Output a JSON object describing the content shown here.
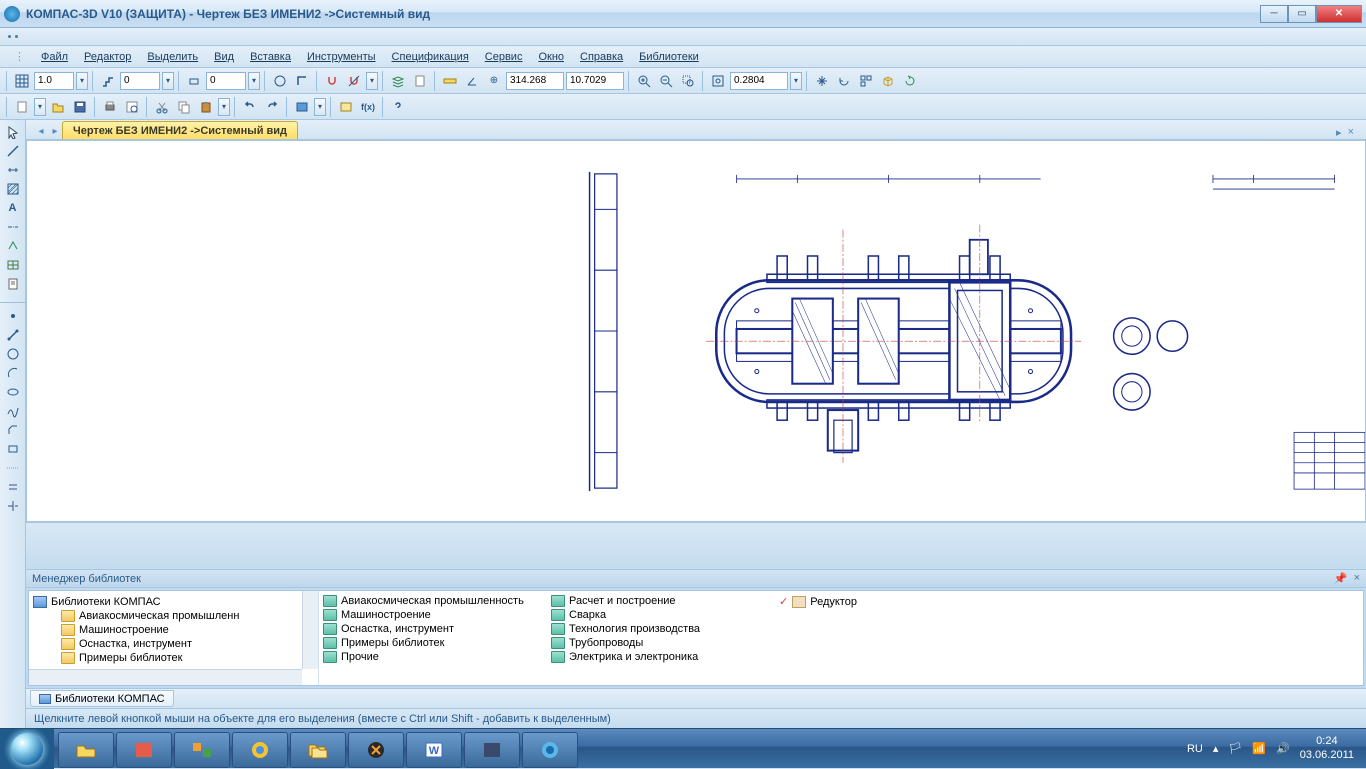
{
  "title": "КОМПАС-3D V10 (ЗАЩИТА) - Чертеж БЕЗ ИМЕНИ2 ->Системный вид",
  "menu": {
    "file": "Файл",
    "editor": "Редактор",
    "select": "Выделить",
    "view": "Вид",
    "insert": "Вставка",
    "tools": "Инструменты",
    "spec": "Спецификация",
    "service": "Сервис",
    "window": "Окно",
    "help": "Справка",
    "libs": "Библиотеки"
  },
  "toolbar1": {
    "scale": "1.0",
    "step": "0",
    "style": "0",
    "x": "314.268",
    "y": "10.7029",
    "zoom": "0.2804"
  },
  "docTab": "Чертеж БЕЗ ИМЕНИ2 ->Системный вид",
  "libMgr": {
    "title": "Менеджер библиотек",
    "treeRoot": "Библиотеки КОМПАС",
    "tree": [
      "Авиакосмическая промышленн",
      "Машиностроение",
      "Оснастка, инструмент",
      "Примеры библиотек"
    ],
    "col1": [
      "Авиакосмическая промышленность",
      "Машиностроение",
      "Оснастка, инструмент",
      "Примеры библиотек",
      "Прочие"
    ],
    "col2": [
      "Расчет и построение",
      "Сварка",
      "Технология производства",
      "Трубопроводы",
      "Электрика и электроника"
    ],
    "col3": [
      "Редуктор"
    ]
  },
  "bottomTab": "Библиотеки КОМПАС",
  "status": "Щелкните левой кнопкой мыши на объекте для его выделения (вместе с Ctrl или Shift - добавить к выделенным)",
  "tray": {
    "lang": "RU",
    "time": "0:24",
    "date": "03.06.2011"
  }
}
